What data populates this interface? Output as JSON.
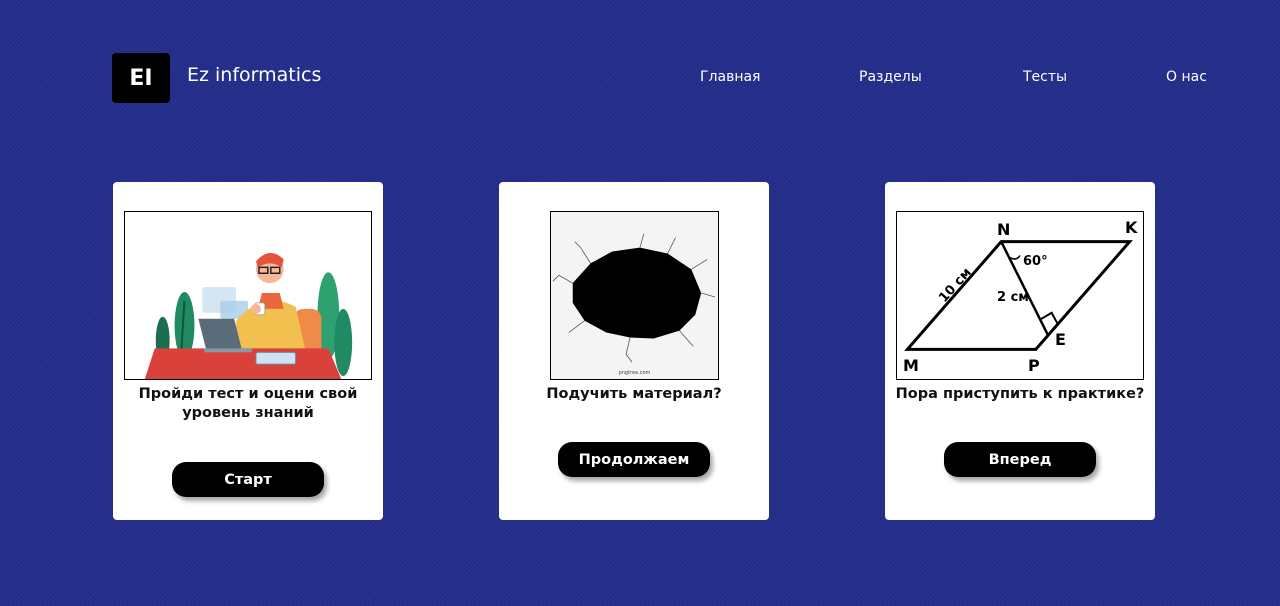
{
  "header": {
    "logo_text": "EI",
    "brand": "Ez informatics",
    "nav": [
      "Главная",
      "Разделы",
      "Тесты",
      "О нас"
    ]
  },
  "cards": [
    {
      "image": "person-at-laptop-illustration",
      "text": "Пройди тест и оцени свой уровень знаний",
      "button": "Старт"
    },
    {
      "image": "black-hole-in-wall-image",
      "text": "Подучить материал?",
      "button": "Продолжаем",
      "image_caption": "pngtree.com"
    },
    {
      "image": "parallelogram-geometry-problem",
      "text": "Пора приступить к практике?",
      "button": "Вперед",
      "figure_labels": {
        "N": "N",
        "K": "K",
        "M": "M",
        "P": "P",
        "E": "E",
        "side": "10 см",
        "height": "2 см",
        "angle": "60°"
      }
    }
  ],
  "colors": {
    "background": "#232e8c",
    "card": "#ffffff",
    "button": "#000000"
  }
}
